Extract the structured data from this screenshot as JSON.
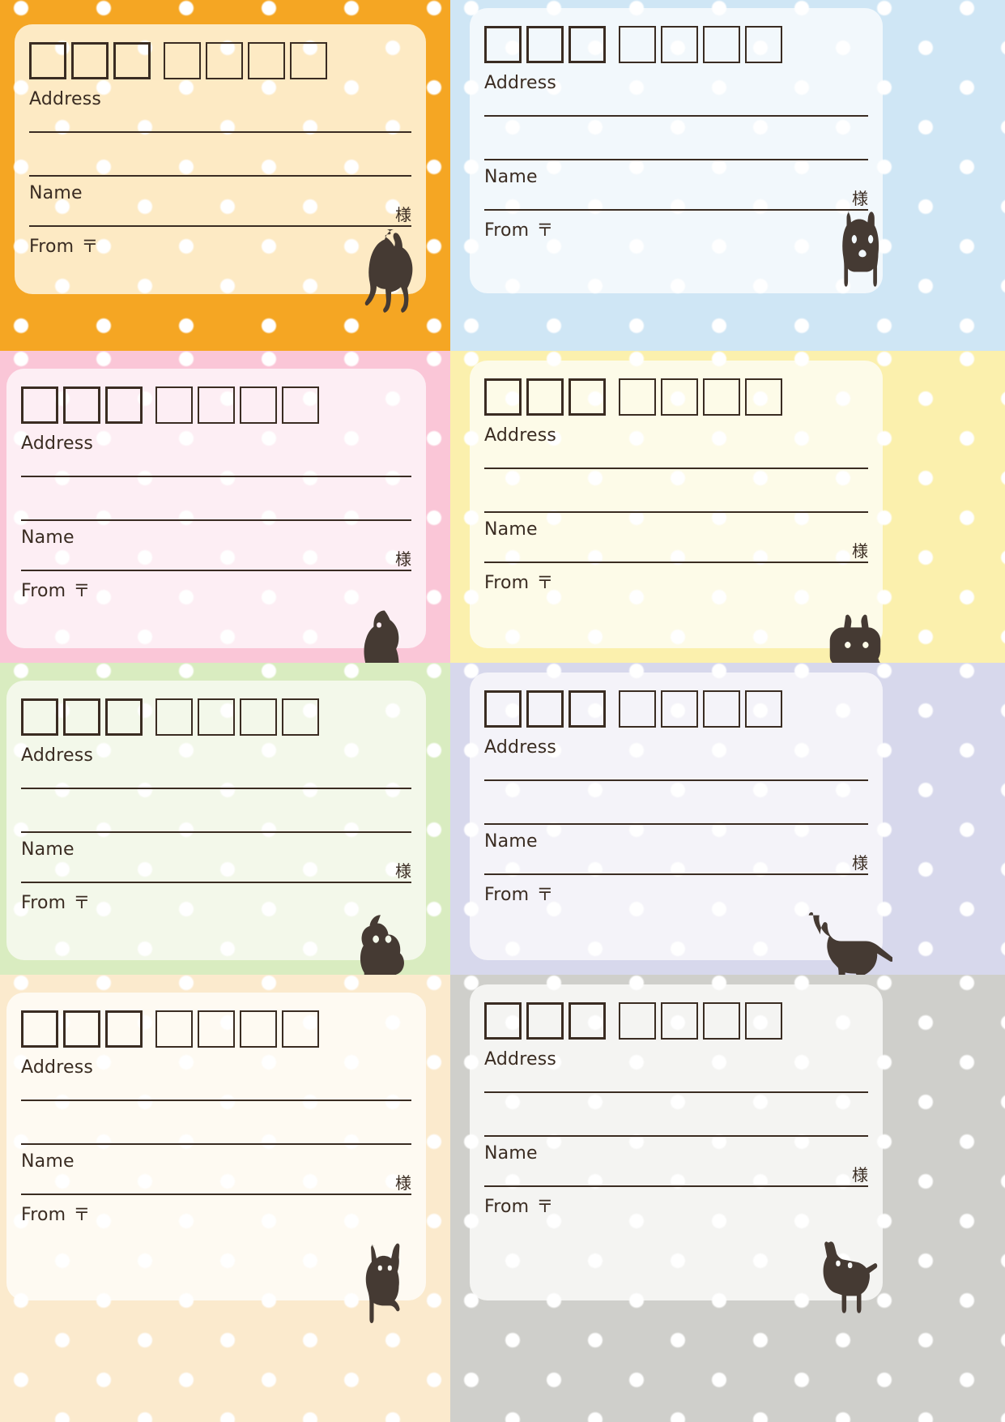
{
  "sheet": {
    "title": "Address Label Sheet",
    "columns": 2,
    "rows": 4,
    "zip_box_count": 7,
    "zip_box_split_after": 3
  },
  "labels": {
    "address": "Address",
    "name": "Name",
    "from": "From",
    "postal_mark": "〒",
    "honorific": "様"
  },
  "ink_color": "#3a2c22",
  "cards": [
    {
      "id": "card-orange",
      "panel_color": "#f5a623",
      "card_color": "#fdeac4",
      "dot_color": "#ffffff",
      "dog": "long-haired-chihuahua",
      "address": "Address",
      "name": "Name",
      "from": "From",
      "postal_mark": "〒",
      "honorific": "様"
    },
    {
      "id": "card-blue",
      "panel_color": "#cfe6f5",
      "card_color": "#f2f8fc",
      "dot_color": "#ffffff",
      "dog": "french-bulldog",
      "address": "Address",
      "name": "Name",
      "from": "From",
      "postal_mark": "〒",
      "honorific": "様"
    },
    {
      "id": "card-pink",
      "panel_color": "#fac6d7",
      "card_color": "#fdeef4",
      "dot_color": "#ffffff",
      "dog": "labrador-sitting",
      "address": "Address",
      "name": "Name",
      "from": "From",
      "postal_mark": "〒",
      "honorific": "様"
    },
    {
      "id": "card-yellow",
      "panel_color": "#fbf0ad",
      "card_color": "#fdfbe8",
      "dot_color": "#ffffff",
      "dog": "corgi",
      "address": "Address",
      "name": "Name",
      "from": "From",
      "postal_mark": "〒",
      "honorific": "様"
    },
    {
      "id": "card-green",
      "panel_color": "#d9ecc0",
      "card_color": "#f3f8ea",
      "dot_color": "#ffffff",
      "dog": "poodle",
      "address": "Address",
      "name": "Name",
      "from": "From",
      "postal_mark": "〒",
      "honorific": "様"
    },
    {
      "id": "card-lavender",
      "panel_color": "#d7d8ec",
      "card_color": "#f4f3f9",
      "dot_color": "#ffffff",
      "dog": "doberman",
      "address": "Address",
      "name": "Name",
      "from": "From",
      "postal_mark": "〒",
      "honorific": "様"
    },
    {
      "id": "card-cream",
      "panel_color": "#fbeacd",
      "card_color": "#fefaf2",
      "dot_color": "#ffffff",
      "dog": "chihuahua-sitting",
      "address": "Address",
      "name": "Name",
      "from": "From",
      "postal_mark": "〒",
      "honorific": "様"
    },
    {
      "id": "card-gray",
      "panel_color": "#cfcfcb",
      "card_color": "#f4f4f2",
      "dot_color": "#ffffff",
      "dog": "shiba-inu",
      "address": "Address",
      "name": "Name",
      "from": "From",
      "postal_mark": "〒",
      "honorific": "様"
    }
  ]
}
